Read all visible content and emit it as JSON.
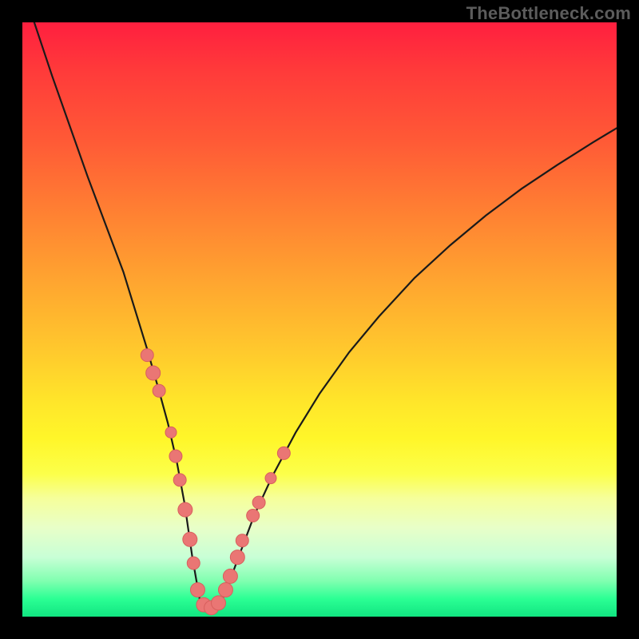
{
  "watermark": "TheBottleneck.com",
  "colors": {
    "background": "#000000",
    "curve": "#1a1a1a",
    "dot_fill": "#ea7674",
    "dot_stroke": "#d85f5d"
  },
  "chart_data": {
    "type": "line",
    "title": "",
    "xlabel": "",
    "ylabel": "",
    "xlim": [
      0,
      100
    ],
    "ylim": [
      0,
      100
    ],
    "x": [
      2,
      5,
      8,
      11,
      14,
      17,
      19,
      21,
      23,
      24.5,
      26,
      27.3,
      28.6,
      30,
      32,
      34,
      36,
      39,
      42,
      46,
      50,
      55,
      60,
      66,
      72,
      78,
      84,
      90,
      96,
      100
    ],
    "values": [
      100,
      91,
      82.5,
      74,
      66,
      58,
      51.5,
      45,
      38,
      32.5,
      26,
      19,
      10,
      2,
      1.5,
      3.5,
      9,
      17,
      23.5,
      31,
      37.5,
      44.5,
      50.5,
      57,
      62.5,
      67.5,
      72,
      76,
      79.8,
      82.2
    ],
    "series": [
      {
        "name": "dots",
        "type": "scatter",
        "points": [
          {
            "x": 21.0,
            "y": 44.0,
            "r": 8
          },
          {
            "x": 22.0,
            "y": 41.0,
            "r": 9
          },
          {
            "x": 23.0,
            "y": 38.0,
            "r": 8
          },
          {
            "x": 25.0,
            "y": 31.0,
            "r": 7
          },
          {
            "x": 25.8,
            "y": 27.0,
            "r": 8
          },
          {
            "x": 26.5,
            "y": 23.0,
            "r": 8
          },
          {
            "x": 27.4,
            "y": 18.0,
            "r": 9
          },
          {
            "x": 28.2,
            "y": 13.0,
            "r": 9
          },
          {
            "x": 28.8,
            "y": 9.0,
            "r": 8
          },
          {
            "x": 29.5,
            "y": 4.5,
            "r": 9
          },
          {
            "x": 30.5,
            "y": 2.0,
            "r": 9
          },
          {
            "x": 31.8,
            "y": 1.5,
            "r": 9
          },
          {
            "x": 33.0,
            "y": 2.3,
            "r": 9
          },
          {
            "x": 34.2,
            "y": 4.5,
            "r": 9
          },
          {
            "x": 35.0,
            "y": 6.8,
            "r": 9
          },
          {
            "x": 36.2,
            "y": 10.0,
            "r": 9
          },
          {
            "x": 37.0,
            "y": 12.8,
            "r": 8
          },
          {
            "x": 38.8,
            "y": 17.0,
            "r": 8
          },
          {
            "x": 39.8,
            "y": 19.2,
            "r": 8
          },
          {
            "x": 41.8,
            "y": 23.3,
            "r": 7
          },
          {
            "x": 44.0,
            "y": 27.5,
            "r": 8
          }
        ]
      }
    ]
  }
}
